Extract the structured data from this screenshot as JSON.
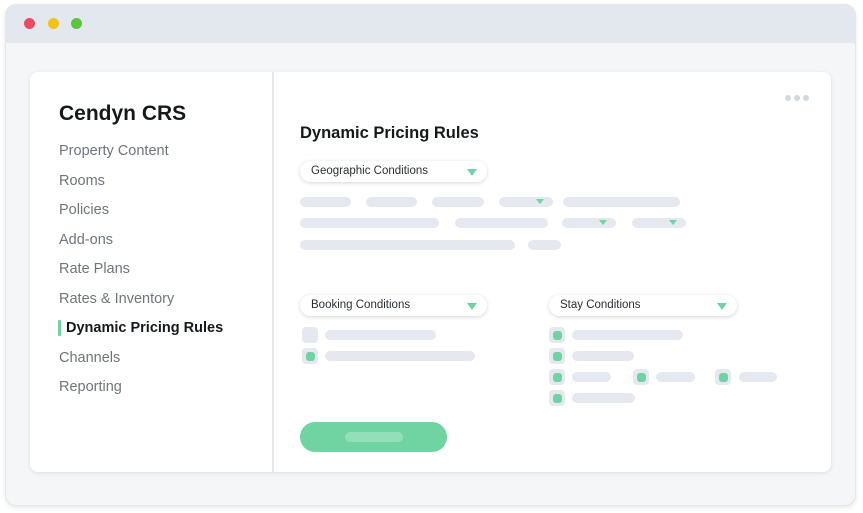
{
  "window": {
    "controls": [
      "close-dot",
      "minimize-dot",
      "maximize-dot"
    ],
    "colors": {
      "close": "#ec4b5f",
      "minimize": "#f2c218",
      "maximize": "#5cc53a"
    }
  },
  "sidebar": {
    "brand": "Cendyn CRS",
    "items": [
      {
        "label": "Property Content"
      },
      {
        "label": "Rooms"
      },
      {
        "label": "Policies"
      },
      {
        "label": "Add-ons"
      },
      {
        "label": "Rate Plans"
      },
      {
        "label": "Rates & Inventory"
      },
      {
        "label": "Dynamic Pricing Rules",
        "active": true
      },
      {
        "label": "Channels"
      },
      {
        "label": "Reporting"
      }
    ]
  },
  "main": {
    "title": "Dynamic Pricing Rules",
    "more_icon": "ellipsis-icon",
    "geographic": {
      "label": "Geographic Conditions"
    },
    "booking": {
      "label": "Booking Conditions",
      "checkboxes": [
        false,
        true
      ]
    },
    "stay": {
      "label": "Stay Conditions",
      "checkboxes": [
        true,
        true,
        true,
        true,
        true,
        true
      ]
    }
  },
  "colors": {
    "accent": "#6fd3a2",
    "placeholder": "#e5e9ef",
    "text": "#16191c",
    "muted": "#70757b"
  }
}
